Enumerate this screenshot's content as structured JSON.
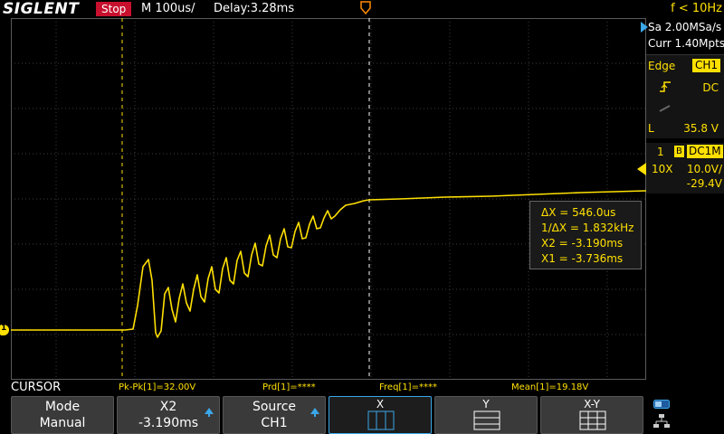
{
  "topbar": {
    "brand": "SIGLENT",
    "run_state": "Stop",
    "timebase": "M 100us/",
    "delay": "Delay:3.28ms",
    "trigger_freq": "f < 10Hz"
  },
  "acquisition": {
    "sample_rate": "Sa 2.00MSa/s",
    "memory": "Curr 1.40Mpts"
  },
  "trigger": {
    "type": "Edge",
    "source": "CH1",
    "coupling": "DC",
    "level_label": "L",
    "level": "35.8 V"
  },
  "channel": {
    "number": "1",
    "bandwidth_flag": "B",
    "coupling": "DC1M",
    "probe": "10X",
    "scale": "10.0V/",
    "offset": "-29.4V",
    "marker": "1"
  },
  "cursor_readout": {
    "dx": "ΔX = 546.0us",
    "inv_dx": "1/ΔX = 1.832kHz",
    "x2": "X2 = -3.190ms",
    "x1": "X1 = -3.736ms"
  },
  "measurements": {
    "menu_title": "CURSOR",
    "pkpk": "Pk-Pk[1]=32.00V",
    "prd": "Prd[1]=****",
    "freq": "Freq[1]=****",
    "mean": "Mean[1]=19.18V"
  },
  "softkeys": {
    "mode_title": "Mode",
    "mode_value": "Manual",
    "x2_title": "X2",
    "x2_value": "-3.190ms",
    "source_title": "Source",
    "source_value": "CH1",
    "x_label": "X",
    "y_label": "Y",
    "xy_label": "X-Y"
  },
  "colors": {
    "channel1": "#ffe000",
    "grid": "#444444",
    "accent": "#3aa7e8",
    "stop": "#c8102e"
  }
}
